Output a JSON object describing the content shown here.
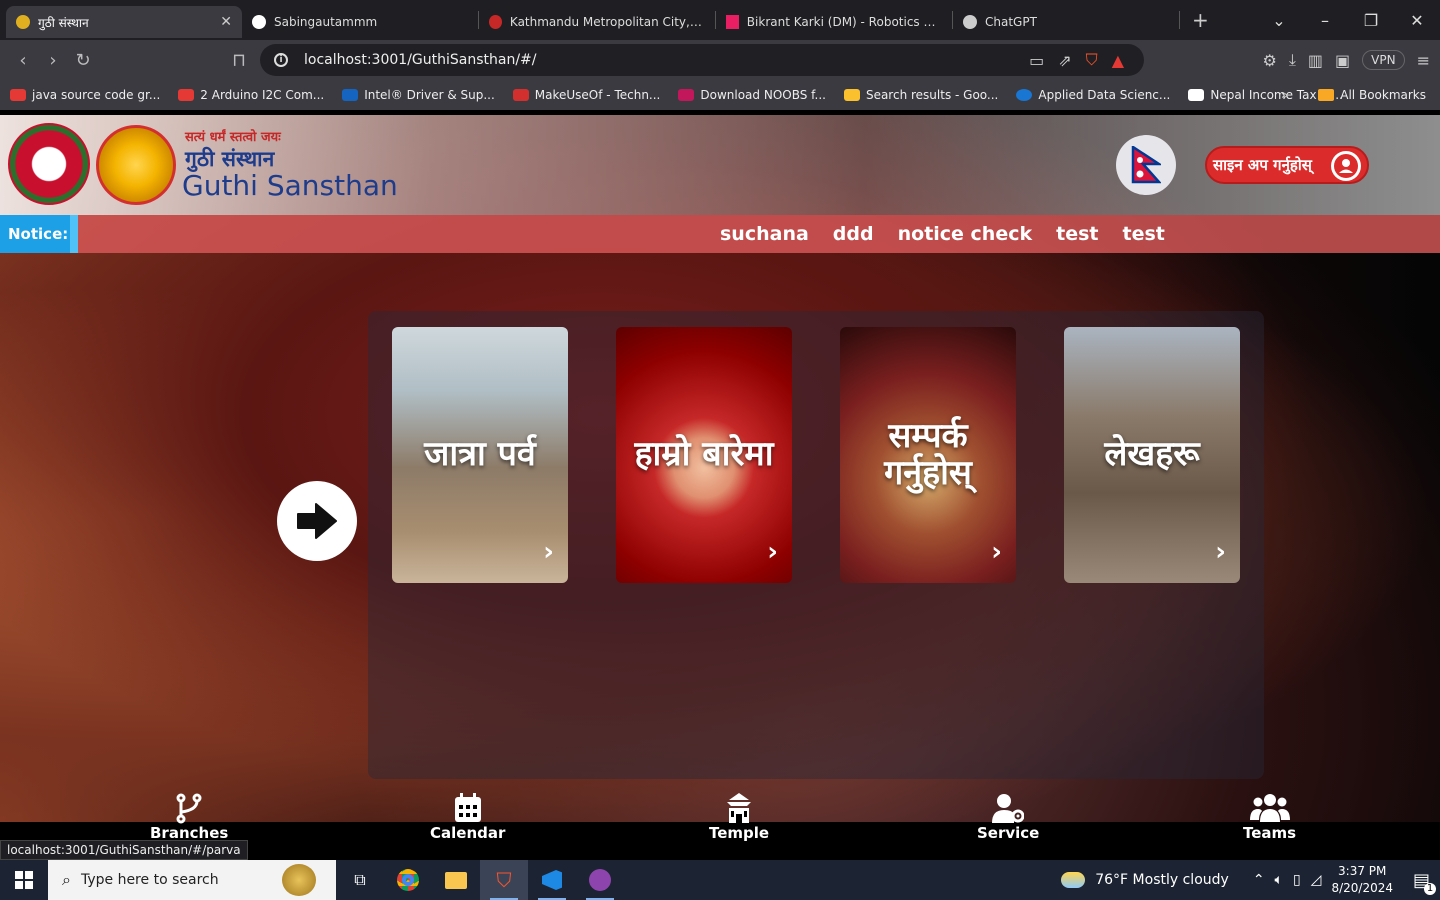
{
  "browser": {
    "tabs": [
      {
        "title": "गुठी संस्थान",
        "active": true
      },
      {
        "title": "Sabingautammm"
      },
      {
        "title": "Kathmandu Metropolitan City, Offic"
      },
      {
        "title": "Bikrant Karki (DM) - Robotics Acade"
      },
      {
        "title": "ChatGPT"
      }
    ],
    "url": "localhost:3001/GuthiSansthan/#/",
    "vpn_label": "VPN",
    "bookmarks": [
      {
        "label": "java source code gr...",
        "color": "#e53935"
      },
      {
        "label": "2 Arduino I2C Com...",
        "color": "#e53935"
      },
      {
        "label": "Intel® Driver & Sup...",
        "color": "#1565c0"
      },
      {
        "label": "MakeUseOf - Techn...",
        "color": "#d32f2f"
      },
      {
        "label": "Download NOOBS f...",
        "color": "#c2185b"
      },
      {
        "label": "Search results - Goo...",
        "color": "#fbc02d"
      },
      {
        "label": "Applied Data Scienc...",
        "color": "#1976d2"
      },
      {
        "label": "Nepal Income Tax Sl...",
        "color": "#fff"
      }
    ],
    "all_bookmarks": "All Bookmarks",
    "status_url": "localhost:3001/GuthiSansthan/#/parva"
  },
  "header": {
    "motto": "सत्यं धर्मं स्तत्वो जयः",
    "name_np": "गुठी संस्थान",
    "name_en": "Guthi Sansthan",
    "signup_label": "साइन अप गर्नुहोस्"
  },
  "notice": {
    "label": "Notice:",
    "items": [
      "suchana",
      "ddd",
      "notice check",
      "test",
      "test"
    ]
  },
  "cards": [
    {
      "title": "जात्रा पर्व"
    },
    {
      "title": "हाम्रो बारेमा"
    },
    {
      "title": "सम्पर्क गर्नुहोस्"
    },
    {
      "title": "लेखहरू"
    }
  ],
  "bottom_nav": [
    "Branches",
    "Calendar",
    "Temple",
    "Service",
    "Teams"
  ],
  "taskbar": {
    "search_placeholder": "Type here to search",
    "weather": "76°F  Mostly cloudy",
    "time": "3:37 PM",
    "date": "8/20/2024",
    "notification_count": "1"
  }
}
